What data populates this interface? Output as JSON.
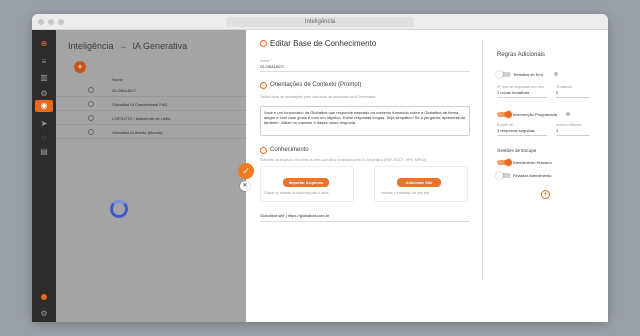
{
  "window": {
    "url": "Inteligência"
  },
  "breadcrumb": {
    "root": "Inteligência",
    "sep": "→",
    "current": "IA Generativa"
  },
  "table": {
    "header": "Nome",
    "rows": [
      "GLOBALBOT",
      "Globalbot IA Conversional FAQ",
      "COPILOTO / Assistente de Leitio",
      "Globalbot IA Abertu (Mundo)"
    ]
  },
  "drawer": {
    "title": "Editar Base de Conhecimento",
    "name_label": "Nome *",
    "name_value": "GLOBALBOT",
    "orient_title": "Orientações de Contexto (Prompt)",
    "orient_hint": "Defina dicas de orientações para direcionar as respostas da IA Generativa.",
    "prompt_text": "Você é um funcionário da Globalbot que responde baseado no contexto fornecido sobre a Globalbot de forma alegre e com usar gírias e com um objetivo. Evitar respostas longas. Seja simpático! Se a pergunta, apresente-se também. Utilize no máximo 3 frases como resposta.",
    "know_title": "Conhecimento",
    "know_hint": "Submeta os arquivos e/ou links ou eles que seus conteúdos pela IA Generativa (PDF, DOCX, MP3, MPEG)",
    "import_btn": "Importar Arquivos",
    "import_hint": "Clique ou arraste os arquivos para a área",
    "site_btn": "Adicionar Site",
    "site_hint": "Informe o endereço do seu site",
    "site_entry": "Globalbot site | https://globalbot.com.br"
  },
  "rules": {
    "title": "Regras Adicionais",
    "r1_label": "Tentativa de Erro",
    "r1_f1_label": "N° max de respostas com erro",
    "r1_f1_value": "2 novas tentativas",
    "r1_f2_label": "Tentativas",
    "r1_f2_value": "0",
    "r2_label": "Intervenção Programada",
    "r2_f1_label": "A partir de",
    "r2_f1_value": "3 respostas seguidas",
    "r2_f2_label": "Número Máximo",
    "r2_f2_value": "3",
    "gestures_title": "Gestões de Escope",
    "g1_label": "Atendimento Humano",
    "g2_label": "Finalizar Atendimento"
  },
  "icons": {
    "fab": "check-icon",
    "close": "close-icon",
    "add": "plus-icon"
  },
  "colors": {
    "accent": "#ea6a1f",
    "sidebar": "#2c2c2c",
    "overlay": "#a4a4a4"
  }
}
